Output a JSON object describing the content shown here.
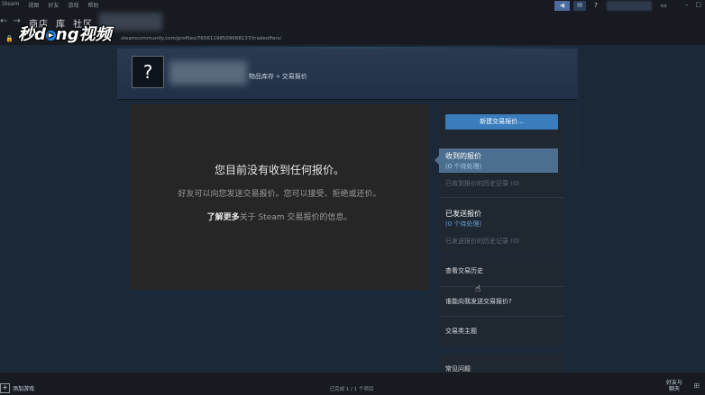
{
  "menu": {
    "items": [
      "Steam",
      "视图",
      "好友",
      "游戏",
      "帮助"
    ]
  },
  "topbar": {
    "help_label": "?"
  },
  "nav": {
    "back": "←",
    "forward": "→",
    "links": [
      "商店",
      "库",
      "社区"
    ]
  },
  "url": {
    "lock_icon": "lock-icon",
    "text": "steamcommunity.com/profiles/76561198509668137/tradeoffers/"
  },
  "watermark": {
    "text_a": "秒d",
    "text_b": "ng视频"
  },
  "header": {
    "avatar_placeholder": "?",
    "breadcrumb_inventory": "物品库存",
    "breadcrumb_sep": "»",
    "breadcrumb_current": "交易报价"
  },
  "main": {
    "title": "您目前没有收到任何报价。",
    "subtitle": "好友可以向您发送交易报价。您可以接受、拒绝或还价。",
    "learn_more": "了解更多",
    "learn_more_rest": "关于 Steam 交易报价的信息。"
  },
  "sidebar": {
    "new_offer": "新建交易报价...",
    "received_title": "收到的报价",
    "received_pending": "(0 个待处理)",
    "received_history": "已收到报价的历史记录 (0)",
    "sent_title": "已发送报价",
    "sent_pending": "(0 个待处理)",
    "sent_history": "已发送报价的历史记录 (0)",
    "view_history": "查看交易历史",
    "who_can_send": "谁能向我发送交易报价?",
    "trade_topics": "交易类主题",
    "faq": "常见问题"
  },
  "bottom": {
    "add_game": "添加游戏",
    "status": "已完成 1 / 1 个项目",
    "friends_line1": "好友与",
    "friends_line2": "聊天"
  },
  "colors": {
    "accent_button": "#3a7dbd",
    "selected_item": "#4d6f8f",
    "link_blue": "#66a1d3",
    "background": "#1b2838"
  }
}
